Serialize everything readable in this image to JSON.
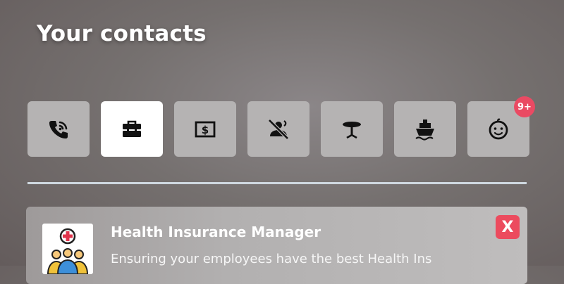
{
  "header": {
    "title": "Your contacts"
  },
  "tabs": [
    {
      "icon": "phone-wifi-icon",
      "active": false
    },
    {
      "icon": "toolbox-icon",
      "active": true
    },
    {
      "icon": "money-bill-icon",
      "active": false
    },
    {
      "icon": "no-smoking-icon",
      "active": false
    },
    {
      "icon": "table-icon",
      "active": false
    },
    {
      "icon": "ship-icon",
      "active": false
    },
    {
      "icon": "baby-face-icon",
      "active": false,
      "badge": "9+"
    }
  ],
  "card": {
    "title": "Health Insurance Manager",
    "description": "Ensuring your employees have the best Health Ins",
    "close_label": "X"
  },
  "colors": {
    "badge": "#ea4a63",
    "close": "#ec4b5e",
    "tab_bg": "#b5b3b3",
    "tab_active_bg": "#ffffff",
    "divider": "#cfd8e0"
  }
}
